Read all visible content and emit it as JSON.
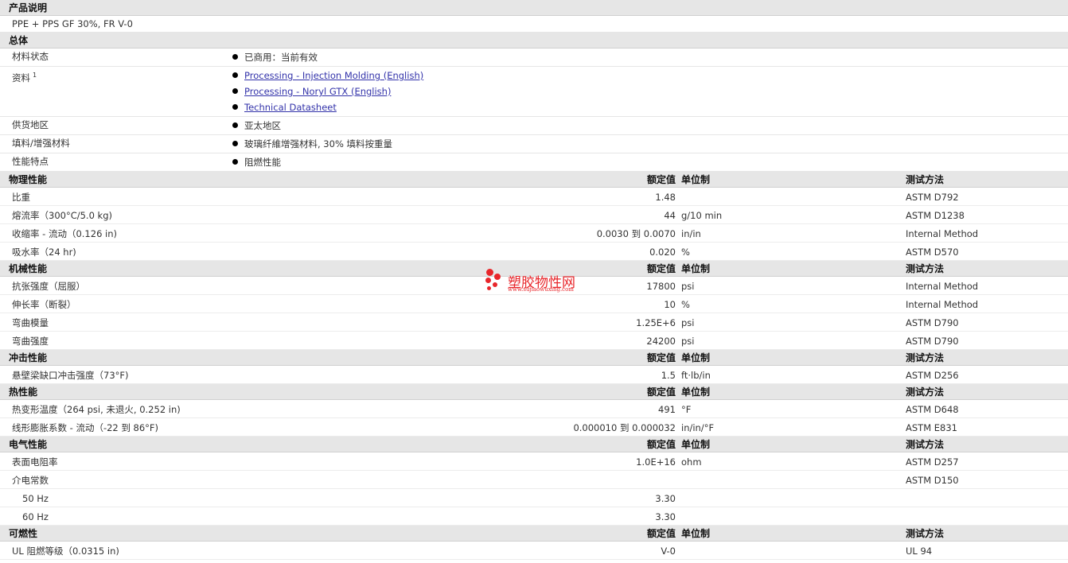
{
  "description": {
    "header": "产品说明",
    "text": "PPE + PPS GF 30%, FR V-0"
  },
  "general": {
    "header": "总体",
    "rows": [
      {
        "label": "材料状态",
        "values": [
          "已商用：当前有效"
        ]
      },
      {
        "label": "资料",
        "sup": "1",
        "links": [
          "Processing - Injection Molding (English)",
          "Processing - Noryl GTX (English)",
          "Technical Datasheet"
        ]
      },
      {
        "label": "供货地区",
        "values": [
          "亚太地区"
        ]
      },
      {
        "label": "填料/增强材料",
        "values": [
          "玻璃纤維增强材料, 30% 填料按重量"
        ]
      },
      {
        "label": "性能特点",
        "values": [
          "阻燃性能"
        ]
      }
    ]
  },
  "columns": {
    "value": "额定值",
    "unit": "单位制",
    "method": "测试方法"
  },
  "sections": [
    {
      "title": "物理性能",
      "rows": [
        {
          "label": "比重",
          "value": "1.48",
          "unit": "",
          "method": "ASTM D792"
        },
        {
          "label": "熔流率（300°C/5.0 kg)",
          "value": "44",
          "unit": "g/10 min",
          "method": "ASTM D1238"
        },
        {
          "label": "收缩率 - 流动（0.126 in)",
          "value": "0.0030 到  0.0070",
          "unit": "in/in",
          "method": "Internal Method"
        },
        {
          "label": "吸水率（24 hr)",
          "value": "0.020",
          "unit": "%",
          "method": "ASTM D570"
        }
      ]
    },
    {
      "title": "机械性能",
      "rows": [
        {
          "label": "抗张强度（屈服）",
          "value": "17800",
          "unit": "psi",
          "method": "Internal Method"
        },
        {
          "label": "伸长率（断裂）",
          "value": "10",
          "unit": "%",
          "method": "Internal Method"
        },
        {
          "label": "弯曲模量",
          "value": "1.25E+6",
          "unit": "psi",
          "method": "ASTM D790"
        },
        {
          "label": "弯曲强度",
          "value": "24200",
          "unit": "psi",
          "method": "ASTM D790"
        }
      ]
    },
    {
      "title": "冲击性能",
      "rows": [
        {
          "label": "悬壁梁缺口冲击强度（73°F)",
          "value": "1.5",
          "unit": "ft·lb/in",
          "method": "ASTM D256"
        }
      ]
    },
    {
      "title": "热性能",
      "rows": [
        {
          "label": "热变形温度（264 psi, 未退火, 0.252 in)",
          "value": "491",
          "unit": "°F",
          "method": "ASTM D648"
        },
        {
          "label": "线形膨胀系数 - 流动（-22 到  86°F)",
          "value": "0.000010 到  0.000032",
          "unit": "in/in/°F",
          "method": "ASTM E831"
        }
      ]
    },
    {
      "title": "电气性能",
      "rows": [
        {
          "label": "表面电阻率",
          "value": "1.0E+16",
          "unit": "ohm",
          "method": "ASTM D257"
        },
        {
          "label": "介电常数",
          "value": "",
          "unit": "",
          "method": "ASTM D150"
        },
        {
          "label": "50 Hz",
          "sub": true,
          "value": "3.30",
          "unit": "",
          "method": ""
        },
        {
          "label": "60 Hz",
          "sub": true,
          "value": "3.30",
          "unit": "",
          "method": ""
        }
      ]
    },
    {
      "title": "可燃性",
      "rows": [
        {
          "label": "UL 阻燃等级（0.0315 in)",
          "value": "V-0",
          "unit": "",
          "method": "UL 94"
        }
      ]
    }
  ],
  "watermark": {
    "name": "塑胶物性网",
    "url": "www.sujiaowuxing.com"
  }
}
